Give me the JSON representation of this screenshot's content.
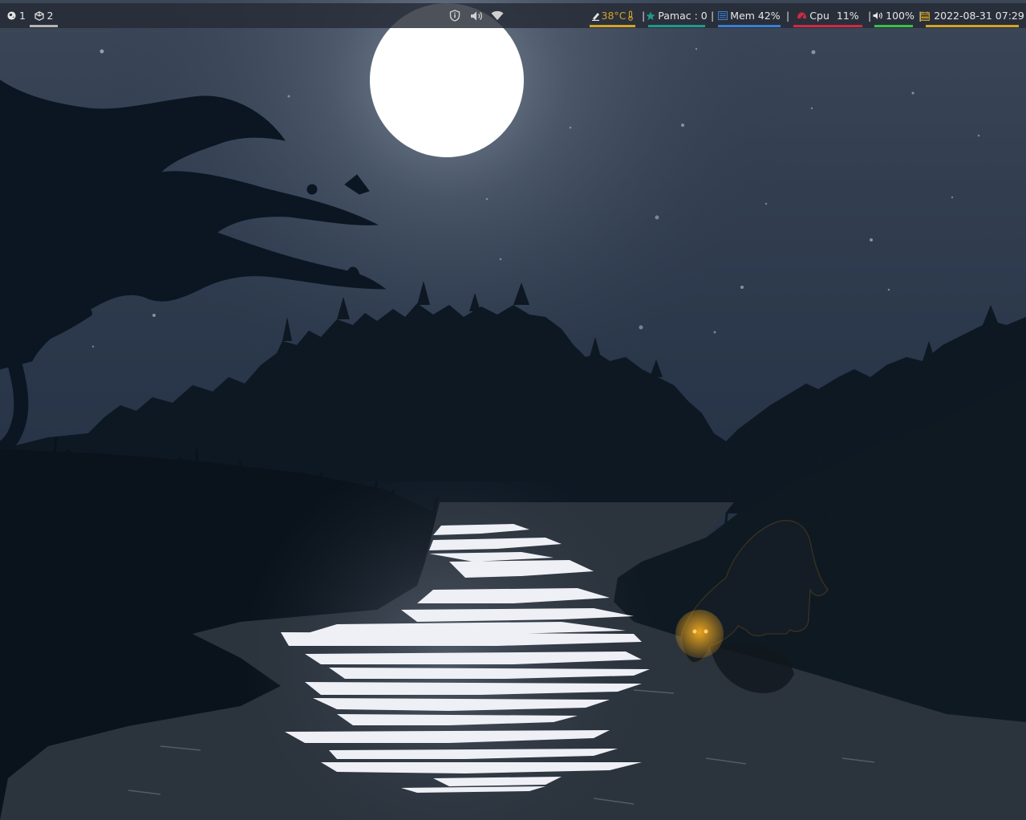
{
  "workspaces": [
    {
      "number": "1",
      "icon": "globe-icon",
      "active": false
    },
    {
      "number": "2",
      "icon": "cube-icon",
      "active": true
    }
  ],
  "tray": {
    "icons": [
      "shield-icon",
      "speaker-icon",
      "wifi-icon"
    ]
  },
  "modules": {
    "temperature": {
      "value": "38°C",
      "icon": "thermometer-icon",
      "color": "#d4a32a"
    },
    "pamac": {
      "text": "Pamac : 0",
      "icon": "star-icon",
      "color": "#1f9a8e"
    },
    "memory": {
      "text": "Mem 42%",
      "icon": "memory-icon",
      "color": "#3a7ed1"
    },
    "cpu": {
      "label": "Cpu",
      "value": "11%",
      "icon": "cpu-icon",
      "color": "#cf2a45"
    },
    "volume": {
      "text": "100%",
      "icon": "volume-icon",
      "color": "#36c24a"
    },
    "clock": {
      "text": "2022-08-31 07:29",
      "icon": "calendar-icon",
      "color": "#d4a32a"
    }
  },
  "separators": [
    "|",
    "|",
    "|",
    "|",
    "|",
    "|"
  ],
  "colors": {
    "bar_bg": "#262b34",
    "moon": "#ffffff",
    "sky_top": "#4c5a6c",
    "sky_bottom": "#1f2d3f",
    "eyes": "#f0a21c"
  }
}
